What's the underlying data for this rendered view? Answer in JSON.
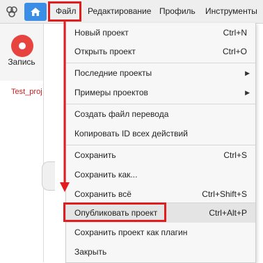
{
  "colors": {
    "accent_blue": "#3a8ee6",
    "record_red": "#e8443f",
    "highlight_red": "#e11d1d",
    "project_tab_red": "#cc1f1f",
    "menu_bg": "#f7f7f7",
    "topbar_bg": "#eeeeee"
  },
  "toolbar": {
    "logo_icon": "app-logo-icon",
    "home_icon": "home-icon",
    "menu": [
      {
        "label": "Файл",
        "active": true
      },
      {
        "label": "Редактирование"
      },
      {
        "label": "Профиль"
      },
      {
        "label": "Инструменты"
      }
    ]
  },
  "sidebar": {
    "record_label": "Запись",
    "project_tab": "Test_proj"
  },
  "file_menu": {
    "items": [
      {
        "label": "Новый проект",
        "shortcut": "Ctrl+N"
      },
      {
        "label": "Открыть проект",
        "shortcut": "Ctrl+O"
      },
      {
        "label": "Последние проекты",
        "submenu": true
      },
      {
        "label": "Примеры проектов",
        "submenu": true
      },
      {
        "label": "Создать файл перевода"
      },
      {
        "label": "Копировать ID всех действий"
      },
      {
        "label": "Сохранить",
        "shortcut": "Ctrl+S"
      },
      {
        "label": "Сохранить как..."
      },
      {
        "label": "Сохранить всё",
        "shortcut": "Ctrl+Shift+S"
      },
      {
        "label": "Опубликовать проект",
        "shortcut": "Ctrl+Alt+P",
        "highlighted": true
      },
      {
        "label": "Сохранить проект как плагин"
      },
      {
        "label": "Закрыть"
      }
    ]
  }
}
